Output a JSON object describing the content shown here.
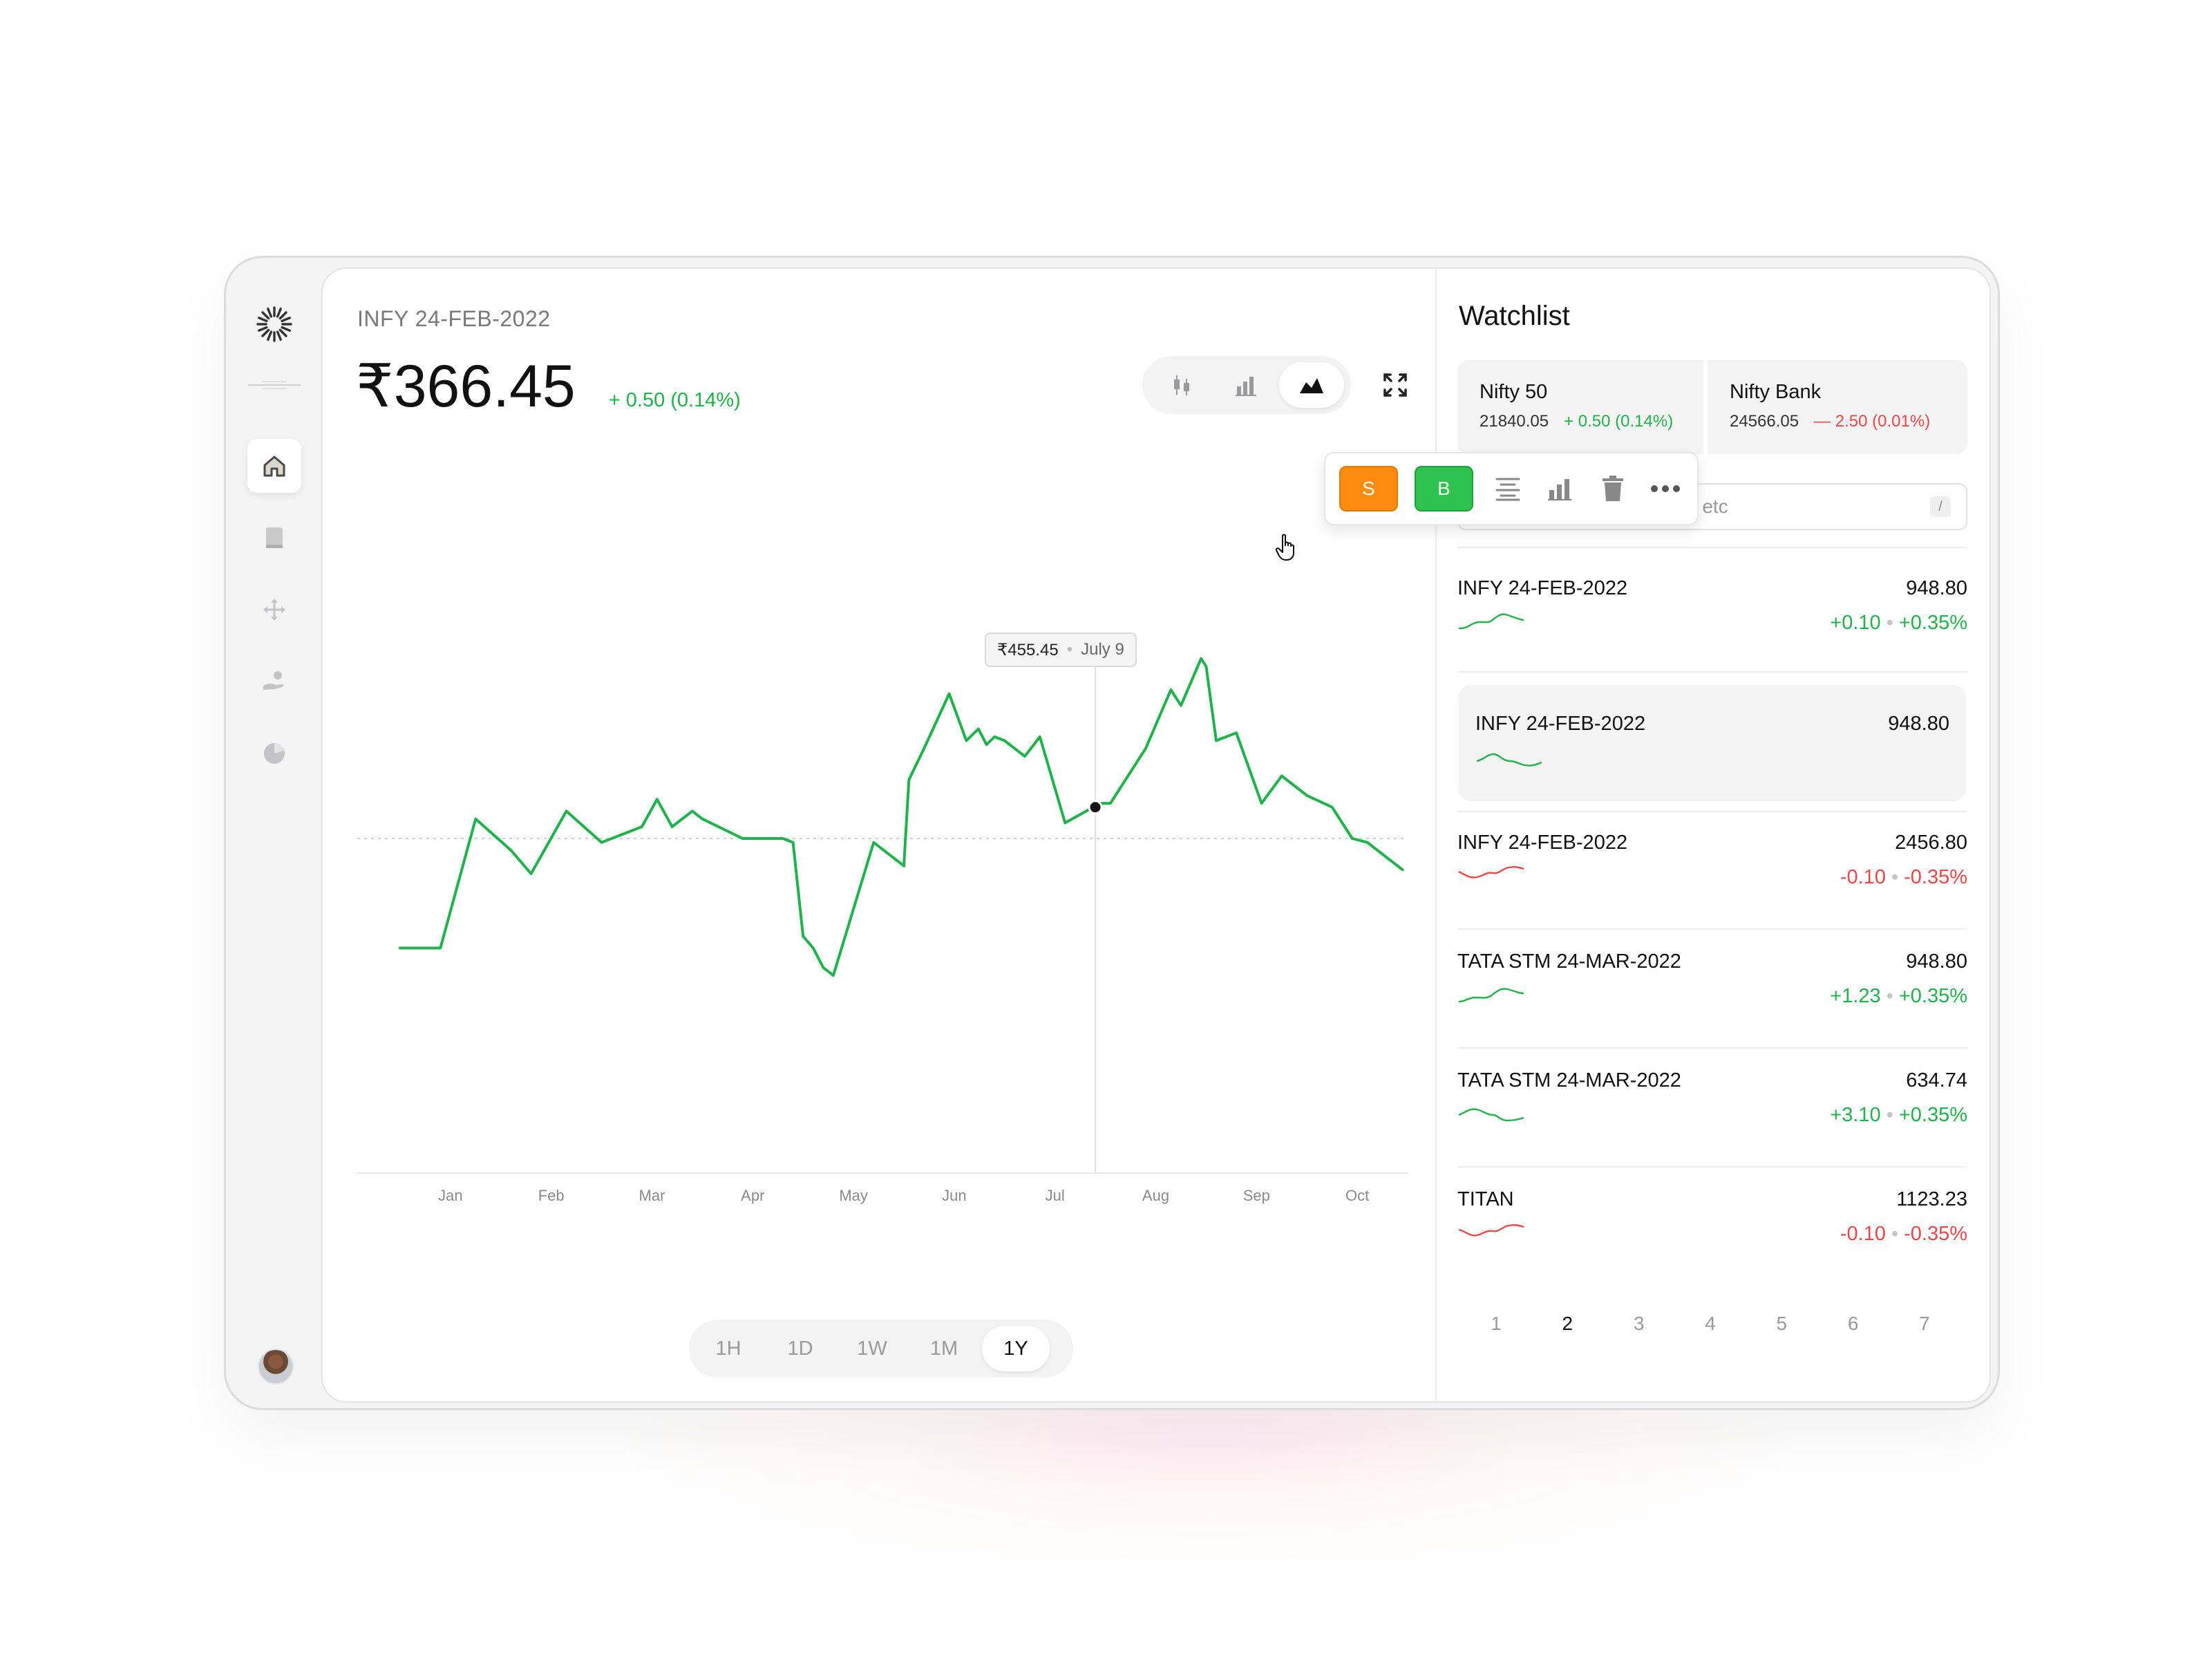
{
  "symbol": {
    "title": "INFY 24-FEB-2022",
    "price": "₹366.45",
    "change": "+ 0.50 (0.14%)"
  },
  "chart_controls": {
    "types": [
      {
        "name": "candlestick-icon",
        "active": false
      },
      {
        "name": "bar-chart-icon",
        "active": false
      },
      {
        "name": "area-chart-icon",
        "active": true
      }
    ],
    "expand_icon": "expand-icon"
  },
  "tooltip": {
    "price": "₹455.45",
    "date": "July 9"
  },
  "time_ranges": [
    {
      "label": "1H",
      "active": false
    },
    {
      "label": "1D",
      "active": false
    },
    {
      "label": "1W",
      "active": false
    },
    {
      "label": "1M",
      "active": false
    },
    {
      "label": "1Y",
      "active": true
    }
  ],
  "chart_data": {
    "type": "line",
    "x_tick_labels": [
      "Jan",
      "Feb",
      "Mar",
      "Apr",
      "May",
      "Jun",
      "Jul",
      "Aug",
      "Sep",
      "Oct"
    ],
    "series": [
      {
        "color": "#22b24c",
        "points": [
          [
            0.0,
            0.25
          ],
          [
            0.4,
            0.25
          ],
          [
            0.75,
            0.58
          ],
          [
            1.1,
            0.5
          ],
          [
            1.3,
            0.44
          ],
          [
            1.65,
            0.6
          ],
          [
            2.0,
            0.52
          ],
          [
            2.4,
            0.56
          ],
          [
            2.55,
            0.63
          ],
          [
            2.7,
            0.56
          ],
          [
            2.9,
            0.6
          ],
          [
            3.0,
            0.58
          ],
          [
            3.4,
            0.53
          ],
          [
            3.7,
            0.53
          ],
          [
            3.8,
            0.53
          ],
          [
            3.9,
            0.52
          ],
          [
            4.0,
            0.28
          ],
          [
            4.1,
            0.25
          ],
          [
            4.2,
            0.2
          ],
          [
            4.3,
            0.18
          ],
          [
            4.7,
            0.52
          ],
          [
            5.0,
            0.46
          ],
          [
            5.05,
            0.68
          ],
          [
            5.2,
            0.76
          ],
          [
            5.45,
            0.9
          ],
          [
            5.62,
            0.78
          ],
          [
            5.74,
            0.81
          ],
          [
            5.82,
            0.77
          ],
          [
            5.9,
            0.79
          ],
          [
            6.0,
            0.78
          ],
          [
            6.2,
            0.74
          ],
          [
            6.35,
            0.79
          ],
          [
            6.6,
            0.57
          ],
          [
            6.95,
            0.62
          ],
          [
            7.05,
            0.62
          ],
          [
            7.4,
            0.76
          ],
          [
            7.65,
            0.91
          ],
          [
            7.75,
            0.87
          ],
          [
            7.95,
            0.99
          ],
          [
            8.0,
            0.97
          ],
          [
            8.1,
            0.78
          ],
          [
            8.3,
            0.8
          ],
          [
            8.55,
            0.62
          ],
          [
            8.75,
            0.69
          ],
          [
            9.0,
            0.64
          ],
          [
            9.25,
            0.61
          ],
          [
            9.45,
            0.53
          ],
          [
            9.6,
            0.52
          ],
          [
            9.95,
            0.45
          ]
        ]
      }
    ],
    "highlight": {
      "x": 6.9,
      "y": 0.61
    }
  },
  "watchlist": {
    "title": "Watchlist",
    "indices": [
      {
        "name": "Nifty 50",
        "value": "21840.05",
        "change": "+ 0.50 (0.14%)",
        "direction": "up"
      },
      {
        "name": "Nifty Bank",
        "value": "24566.05",
        "change": "— 2.50 (0.01%)",
        "direction": "down"
      }
    ],
    "search_placeholder": "Search stocks, indices etc",
    "search_shortcut": "/",
    "items": [
      {
        "name": "INFY 24-FEB-2022",
        "price": "948.80",
        "change": "+0.10",
        "percent": "+0.35%",
        "direction": "up"
      },
      {
        "name": "INFY 24-FEB-2022",
        "price": "948.80",
        "change": "",
        "percent": "",
        "direction": "up"
      },
      {
        "name": "INFY 24-FEB-2022",
        "price": "2456.80",
        "change": "-0.10",
        "percent": "-0.35%",
        "direction": "down"
      },
      {
        "name": "TATA STM 24-MAR-2022",
        "price": "948.80",
        "change": "+1.23",
        "percent": "+0.35%",
        "direction": "up"
      },
      {
        "name": "TATA STM 24-MAR-2022",
        "price": "634.74",
        "change": "+3.10",
        "percent": "+0.35%",
        "direction": "up"
      },
      {
        "name": "TITAN",
        "price": "1123.23",
        "change": "-0.10",
        "percent": "-0.35%",
        "direction": "down"
      }
    ],
    "actions": {
      "sell": "S",
      "buy": "B"
    },
    "pages": [
      "1",
      "2",
      "3",
      "4",
      "5",
      "6",
      "7"
    ],
    "current_page": "2"
  },
  "colors": {
    "positive": "#22b24c",
    "negative": "#ec4848",
    "sell": "#ff8c0f",
    "buy": "#2ec24e"
  }
}
